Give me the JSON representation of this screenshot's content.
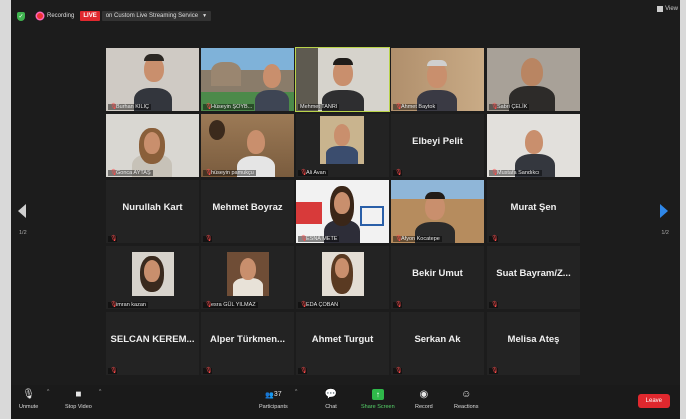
{
  "topbar": {
    "recording_label": "Recording",
    "live_badge": "LIVE",
    "live_service": "on Custom Live Streaming Service",
    "view_label": "View"
  },
  "navigation": {
    "left_page": "1/2",
    "right_page": "1/2"
  },
  "tiles": [
    {
      "label": "Burhan KILIÇ"
    },
    {
      "label": "Hüseyin ŞOYB..."
    },
    {
      "label": "Mehmet TANRI"
    },
    {
      "label": "Ahmet Baytok"
    },
    {
      "label": "Sabri ÇELİK"
    },
    {
      "label": "Gonca AYTAŞ"
    },
    {
      "label": "hüseyin pamukçu"
    },
    {
      "label": "Ali Avan"
    },
    {
      "label": "Elbeyi Pelit"
    },
    {
      "label": "Mustafa Sandıkcı"
    },
    {
      "label": "Nurullah Kart"
    },
    {
      "label": "Mehmet Boyraz"
    },
    {
      "label": "ESNA METE"
    },
    {
      "label": "Afyon Kocatepe"
    },
    {
      "label": "Murat Şen"
    },
    {
      "label": "imran kazan"
    },
    {
      "label": "esra GÜL YILMAZ"
    },
    {
      "label": "EDA ÇOBAN"
    },
    {
      "label": "Bekir Umut"
    },
    {
      "label": "Suat Bayram/Z..."
    },
    {
      "label": "SELCAN KEREM..."
    },
    {
      "label": "Alper Türkmen..."
    },
    {
      "label": "Ahmet Turgut"
    },
    {
      "label": "Serkan Ak"
    },
    {
      "label": "Melisa Ateş"
    }
  ],
  "toolbar": {
    "unmute": "Unmute",
    "stop_video": "Stop Video",
    "participants": "Participants",
    "participants_count": "37",
    "chat": "Chat",
    "share_screen": "Share Screen",
    "record": "Record",
    "reactions": "Reactions",
    "leave": "Leave"
  },
  "colors": {
    "live": "#e0282e",
    "share": "#2fb84a",
    "active_speaker": "#b9d34a",
    "nav_next": "#2f87e8"
  }
}
